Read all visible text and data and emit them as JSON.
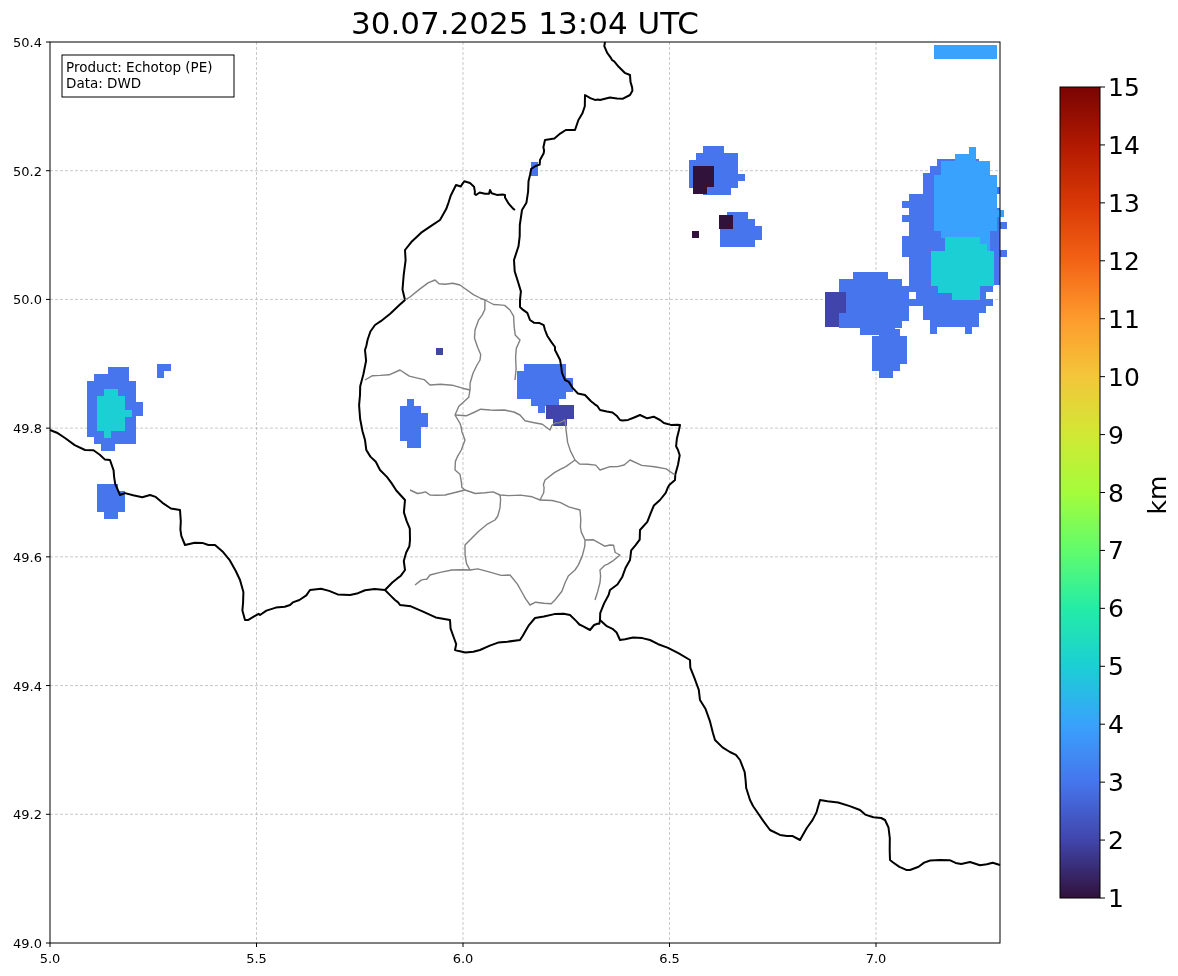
{
  "title": "30.07.2025 13:04 UTC",
  "info_box": [
    "Product: Echotop (PE)",
    "Data: DWD"
  ],
  "map": {
    "xticks": [
      "5.0",
      "5.5",
      "6.0",
      "6.5",
      "7.0"
    ],
    "yticks": [
      "50.4",
      "50.2",
      "50.0",
      "49.8",
      "49.6",
      "49.4",
      "49.2",
      "49.0"
    ]
  },
  "colorbar": {
    "label": "km",
    "ticks": [
      "15",
      "14",
      "13",
      "12",
      "11",
      "10",
      "9",
      "8",
      "7",
      "6",
      "5",
      "4",
      "3",
      "2",
      "1"
    ]
  }
}
